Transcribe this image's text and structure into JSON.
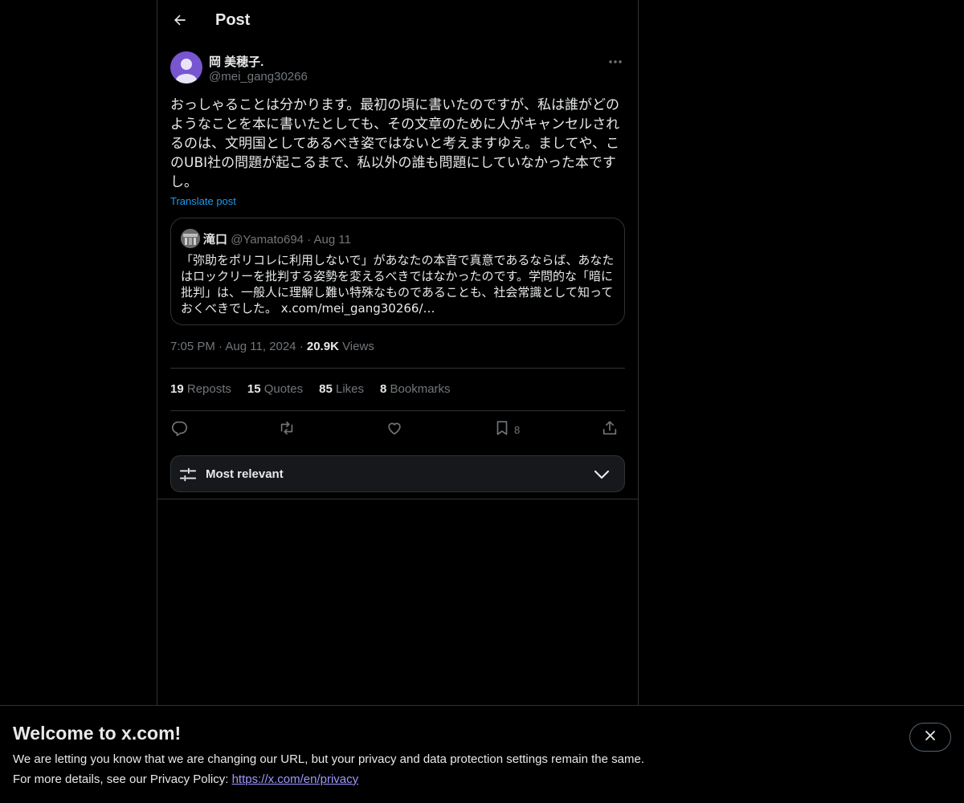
{
  "header": {
    "title": "Post"
  },
  "post": {
    "author_name": "岡 美穂子.",
    "author_handle": "@mei_gang30266",
    "text": "おっしゃることは分かります。最初の頃に書いたのですが、私は誰がどのようなことを本に書いたとしても、その文章のために人がキャンセルされるのは、文明国としてあるべき姿ではないと考えますゆえ。ましてや、このUBI社の問題が起こるまで、私以外の誰も問題にしていなかった本ですし。",
    "translate_label": "Translate post",
    "time": "7:05 PM",
    "date": "Aug 11, 2024",
    "views_count": "20.9K",
    "views_label": "Views",
    "separator": "·"
  },
  "quote": {
    "name": "滝口",
    "handle": "@Yamato694",
    "separator": "·",
    "date": "Aug 11",
    "text": "「弥助をポリコレに利用しないで」があなたの本音で真意であるならば、あなたはロックリーを批判する姿勢を変えるべきではなかったのです。学問的な「暗に批判」は、一般人に理解し難い特殊なものであることも、社会常識として知っておくべきでした。 x.com/mei_gang30266/…"
  },
  "stats": [
    {
      "count": "19",
      "label": "Reposts"
    },
    {
      "count": "15",
      "label": "Quotes"
    },
    {
      "count": "85",
      "label": "Likes"
    },
    {
      "count": "8",
      "label": "Bookmarks"
    }
  ],
  "actions": {
    "bookmark_count": "8"
  },
  "icons": {
    "back": "arrow-left-icon",
    "more": "more-horizontal-icon",
    "reply": "reply-icon",
    "repost": "repost-icon",
    "like": "heart-icon",
    "bookmark": "bookmark-icon",
    "share": "share-icon",
    "sort": "sliders-icon",
    "chevron": "chevron-down-icon",
    "close": "close-icon"
  },
  "sort": {
    "label": "Most relevant"
  },
  "banner": {
    "title": "Welcome to x.com!",
    "line1": "We are letting you know that we are changing our URL, but your privacy and data protection settings remain the same.",
    "line2_prefix": "For more details, see our Privacy Policy: ",
    "link": "https://x.com/en/privacy"
  },
  "colors": {
    "background": "#000000",
    "text": "#e7e9ea",
    "muted": "#71767b",
    "accent": "#1d9bf0",
    "border": "#2f3336",
    "link": "#a098ff"
  }
}
